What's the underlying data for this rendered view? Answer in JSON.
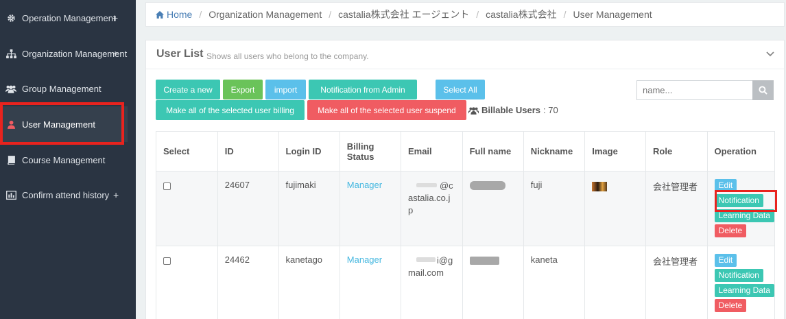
{
  "sidebar": {
    "items": [
      {
        "label": "Operation Management",
        "icon": "gear-icon",
        "has_plus": true
      },
      {
        "label": "Organization Management",
        "icon": "sitemap-icon",
        "has_plus": true
      },
      {
        "label": "Group Management",
        "icon": "users-icon",
        "has_plus": false
      },
      {
        "label": "User Management",
        "icon": "user-icon",
        "has_plus": false,
        "active": true
      },
      {
        "label": "Course Management",
        "icon": "book-icon",
        "has_plus": false
      },
      {
        "label": "Confirm attend history",
        "icon": "bar-chart-icon",
        "has_plus": true
      }
    ],
    "plus": "+"
  },
  "breadcrumb": {
    "items": [
      "Home",
      "Organization Management",
      "castalia株式会社 エージェント",
      "castalia株式会社",
      "User Management"
    ],
    "sep": "/"
  },
  "panel": {
    "title": "User List",
    "subtitle": "Shows all users who belong to the company."
  },
  "toolbar": {
    "create": "Create a new",
    "export": "Export",
    "import": "import",
    "notify_admin": "Notification from Admin",
    "select_all": "Select All",
    "billing": "Make all of the selected user billing",
    "suspend": "Make all of the selected user suspend",
    "billable_label": "Billable Users",
    "billable_count": ": 70"
  },
  "search": {
    "placeholder": "name..."
  },
  "table": {
    "headers": [
      "Select",
      "ID",
      "Login ID",
      "Billing Status",
      "Email",
      "Full name",
      "Nickname",
      "Image",
      "Role",
      "Operation"
    ],
    "billing_header_line1": "Billing",
    "billing_header_line2": "Status",
    "rows": [
      {
        "id": "24607",
        "login_id": "fujimaki",
        "billing": "Manager",
        "email_line1": "@c",
        "email_line2": "astalia.co.j",
        "email_line3": "p",
        "nickname": "fuji",
        "role": "会社管理者"
      },
      {
        "id": "24462",
        "login_id": "kanetago",
        "billing": "Manager",
        "email_line1": "i@g",
        "email_line2": "mail.com",
        "email_line3": "",
        "nickname": "kaneta",
        "role": "会社管理者"
      }
    ],
    "ops": {
      "edit": "Edit",
      "notification": "Notification",
      "learning": "Learning Data",
      "delete": "Delete"
    }
  },
  "colors": {
    "sidebar_bg": "#2a3442",
    "teal": "#3cc7b3",
    "green": "#6ac35a",
    "blue": "#5bc0ea",
    "red": "#f05c62",
    "highlight": "#e8231e",
    "link": "#47b8e0"
  }
}
